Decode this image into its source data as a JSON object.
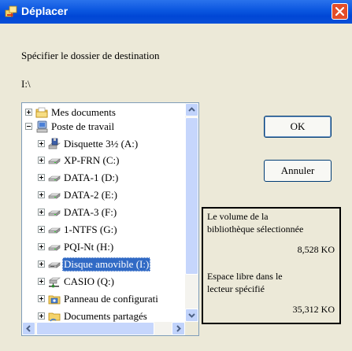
{
  "window": {
    "title": "Déplacer",
    "icon": "move-folder-icon"
  },
  "dialog": {
    "prompt": "Spécifier le dossier de destination",
    "path": "I:\\"
  },
  "tree": {
    "items": [
      {
        "label": "Mes documents",
        "icon": "my-documents-icon",
        "expander": "plus"
      },
      {
        "label": "Poste de travail",
        "icon": "my-computer-icon",
        "expander": "minus"
      },
      {
        "label": "Disquette 3½ (A:)",
        "icon": "floppy-drive-icon",
        "expander": "plus"
      },
      {
        "label": "XP-FRN (C:)",
        "icon": "hard-drive-icon",
        "expander": "plus"
      },
      {
        "label": "DATA-1 (D:)",
        "icon": "hard-drive-icon",
        "expander": "plus"
      },
      {
        "label": "DATA-2 (E:)",
        "icon": "hard-drive-icon",
        "expander": "plus"
      },
      {
        "label": "DATA-3 (F:)",
        "icon": "hard-drive-icon",
        "expander": "plus"
      },
      {
        "label": "1-NTFS (G:)",
        "icon": "hard-drive-icon",
        "expander": "plus"
      },
      {
        "label": "PQI-Nt (H:)",
        "icon": "hard-drive-icon",
        "expander": "plus"
      },
      {
        "label": "Disque amovible (I:)",
        "icon": "removable-disk-icon",
        "expander": "plus",
        "selected": true
      },
      {
        "label": "CASIO (Q:)",
        "icon": "network-drive-icon",
        "expander": "plus"
      },
      {
        "label": "Panneau de configurati",
        "icon": "control-panel-icon",
        "expander": "plus"
      },
      {
        "label": "Documents partagés",
        "icon": "shared-folder-icon",
        "expander": "plus"
      }
    ]
  },
  "buttons": {
    "ok": "OK",
    "cancel": "Annuler"
  },
  "info": {
    "volume_label_1": "Le volume de la",
    "volume_label_2": "bibliothèque sélectionnée",
    "volume_value": "8,528  KO",
    "free_label_1": "Espace libre dans le",
    "free_label_2": "lecteur spécifié",
    "free_value": "35,312  KO"
  },
  "colors": {
    "titlebar": "#0a56df",
    "selection": "#316ac5",
    "dialog_bg": "#ece9d8"
  }
}
